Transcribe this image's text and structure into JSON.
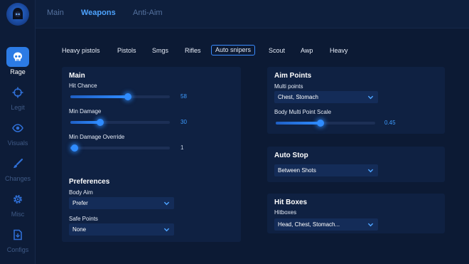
{
  "sidebar": {
    "items": [
      {
        "label": "Rage",
        "icon": "skull-icon",
        "active": true
      },
      {
        "label": "Legit",
        "icon": "crosshair-icon",
        "active": false
      },
      {
        "label": "Visuals",
        "icon": "eye-icon",
        "active": false
      },
      {
        "label": "Changes",
        "icon": "paintbrush-icon",
        "active": false
      },
      {
        "label": "Misc",
        "icon": "gear-icon",
        "active": false
      },
      {
        "label": "Configs",
        "icon": "config-file-icon",
        "active": false
      }
    ]
  },
  "topbar": {
    "tabs": [
      {
        "label": "Main",
        "active": false
      },
      {
        "label": "Weapons",
        "active": true
      },
      {
        "label": "Anti-Aim",
        "active": false
      }
    ]
  },
  "weapon_tabs": [
    {
      "label": "Heavy pistols",
      "active": false
    },
    {
      "label": "Pistols",
      "active": false
    },
    {
      "label": "Smgs",
      "active": false
    },
    {
      "label": "Rifles",
      "active": false
    },
    {
      "label": "Auto snipers",
      "active": true
    },
    {
      "label": "Scout",
      "active": false
    },
    {
      "label": "Awp",
      "active": false
    },
    {
      "label": "Heavy",
      "active": false
    }
  ],
  "main_panel": {
    "title": "Main",
    "hit_chance": {
      "label": "Hit Chance",
      "value": "58",
      "fraction": 0.58
    },
    "min_damage": {
      "label": "Min Damage",
      "value": "30",
      "fraction": 0.3
    },
    "min_damage_override": {
      "label": "Min Damage Override",
      "value": "1",
      "fraction": 0.0
    }
  },
  "preferences_panel": {
    "title": "Preferences",
    "body_aim": {
      "label": "Body Aim",
      "value": "Prefer"
    },
    "safe_points": {
      "label": "Safe Points",
      "value": "None"
    }
  },
  "aim_points_panel": {
    "title": "Aim Points",
    "multi_points": {
      "label": "Multi points",
      "value": "Chest, Stomach"
    },
    "body_multi_point_scale": {
      "label": "Body Multi Point Scale",
      "value": "0.45",
      "fraction": 0.45
    }
  },
  "auto_stop_panel": {
    "title": "Auto Stop",
    "mode": {
      "value": "Between Shots"
    }
  },
  "hit_boxes_panel": {
    "title": "Hit Boxes",
    "hitboxes": {
      "label": "Hitboxes",
      "value": "Head, Chest, Stomach..."
    }
  },
  "colors": {
    "accent": "#2f8cff",
    "background": "#0c1a34",
    "panel": "#0f2142"
  }
}
